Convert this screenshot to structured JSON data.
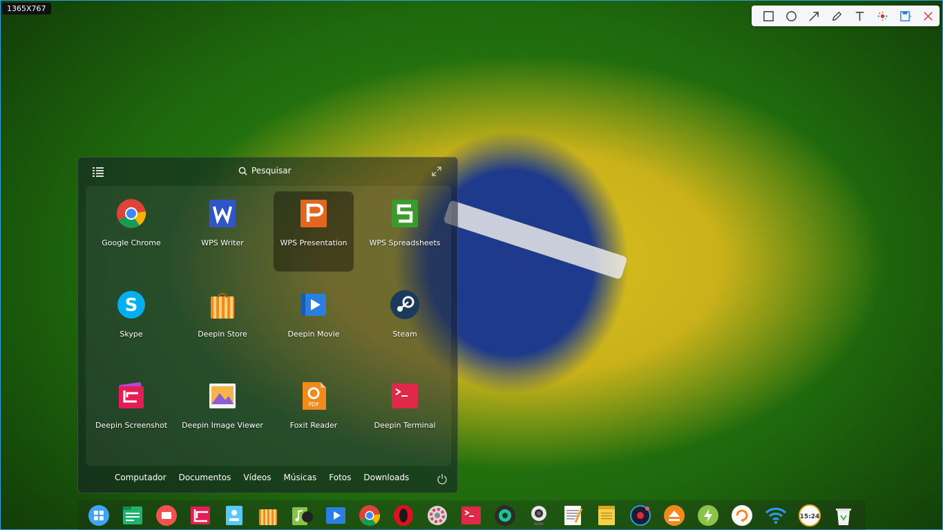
{
  "screen": {
    "size_badge": "1365X767"
  },
  "toolbar": {
    "tools": [
      {
        "name": "rectangle-tool",
        "icon": "square-icon"
      },
      {
        "name": "ellipse-tool",
        "icon": "circle-icon"
      },
      {
        "name": "arrow-tool",
        "icon": "arrow-icon"
      },
      {
        "name": "pencil-tool",
        "icon": "pencil-icon"
      },
      {
        "name": "text-tool",
        "icon": "text-icon"
      },
      {
        "name": "color-tool",
        "icon": "color-dots-icon"
      },
      {
        "name": "save-tool",
        "icon": "save-icon"
      },
      {
        "name": "close-tool",
        "icon": "close-icon"
      }
    ],
    "colors": {
      "accent": "#2b7cd3",
      "close": "#e04848"
    }
  },
  "launcher": {
    "search_placeholder": "Pesquisar",
    "apps": [
      {
        "label": "Google Chrome",
        "icon": "chrome-icon"
      },
      {
        "label": "WPS Writer",
        "icon": "wps-writer-icon"
      },
      {
        "label": "WPS Presentation",
        "icon": "wps-presentation-icon",
        "selected": true
      },
      {
        "label": "WPS Spreadsheets",
        "icon": "wps-spreadsheets-icon"
      },
      {
        "label": "Skype",
        "icon": "skype-icon"
      },
      {
        "label": "Deepin Store",
        "icon": "store-icon"
      },
      {
        "label": "Deepin Movie",
        "icon": "movie-icon"
      },
      {
        "label": "Steam",
        "icon": "steam-icon"
      },
      {
        "label": "Deepin Screenshot",
        "icon": "screenshot-icon"
      },
      {
        "label": "Deepin Image Viewer",
        "icon": "image-viewer-icon"
      },
      {
        "label": "Foxit Reader",
        "icon": "foxit-icon"
      },
      {
        "label": "Deepin Terminal",
        "icon": "terminal-icon"
      }
    ],
    "places": [
      "Computador",
      "Documentos",
      "Vídeos",
      "Músicas",
      "Fotos",
      "Downloads"
    ]
  },
  "dock": {
    "items": [
      "launcher-icon",
      "file-manager-icon",
      "slides-icon",
      "screenshot-icon",
      "image-viewer-icon",
      "store-icon",
      "music-icon",
      "movie-icon",
      "chrome-icon",
      "opera-icon",
      "settings-icon",
      "terminal-icon",
      "webcam-icon",
      "cheese-icon",
      "text-editor-icon",
      "notes-icon",
      "recorder-icon",
      "eject-icon",
      "power-icon",
      "backup-icon",
      "wifi-icon",
      "clock-icon",
      "trash-icon"
    ],
    "clock_text": "15:24"
  }
}
